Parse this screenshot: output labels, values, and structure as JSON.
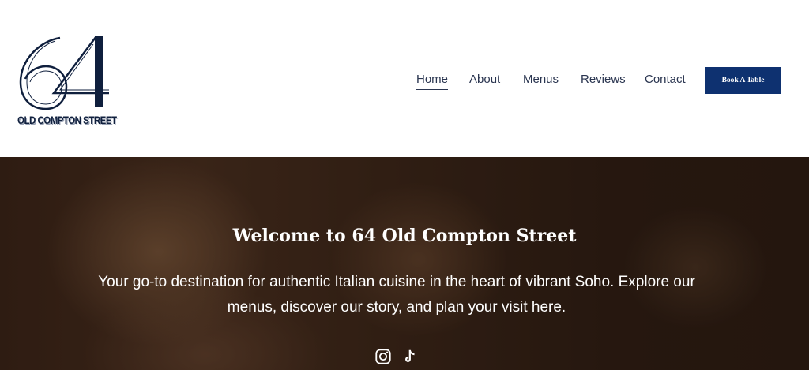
{
  "header": {
    "logo": {
      "numeral": "64",
      "text": "OLD COMPTON STREET"
    },
    "nav": {
      "items": [
        {
          "label": "Home",
          "active": true
        },
        {
          "label": "About",
          "active": false
        },
        {
          "label": "Menus",
          "active": false
        },
        {
          "label": "Reviews",
          "active": false
        },
        {
          "label": "Contact",
          "active": false
        }
      ]
    },
    "cta": {
      "label": "Book A Table"
    }
  },
  "hero": {
    "title": "Welcome to 64 Old Compton Street",
    "body": "Your go-to destination for authentic Italian cuisine in the heart of vibrant Soho. Explore our menus, discover our story, and plan your visit here.",
    "social": [
      {
        "icon": "instagram-icon"
      },
      {
        "icon": "tiktok-icon"
      }
    ]
  },
  "colors": {
    "brand_navy": "#0e3170",
    "logo_navy": "#0f1f3d",
    "nav_text": "#2a3550",
    "hero_text": "#ffffff"
  }
}
